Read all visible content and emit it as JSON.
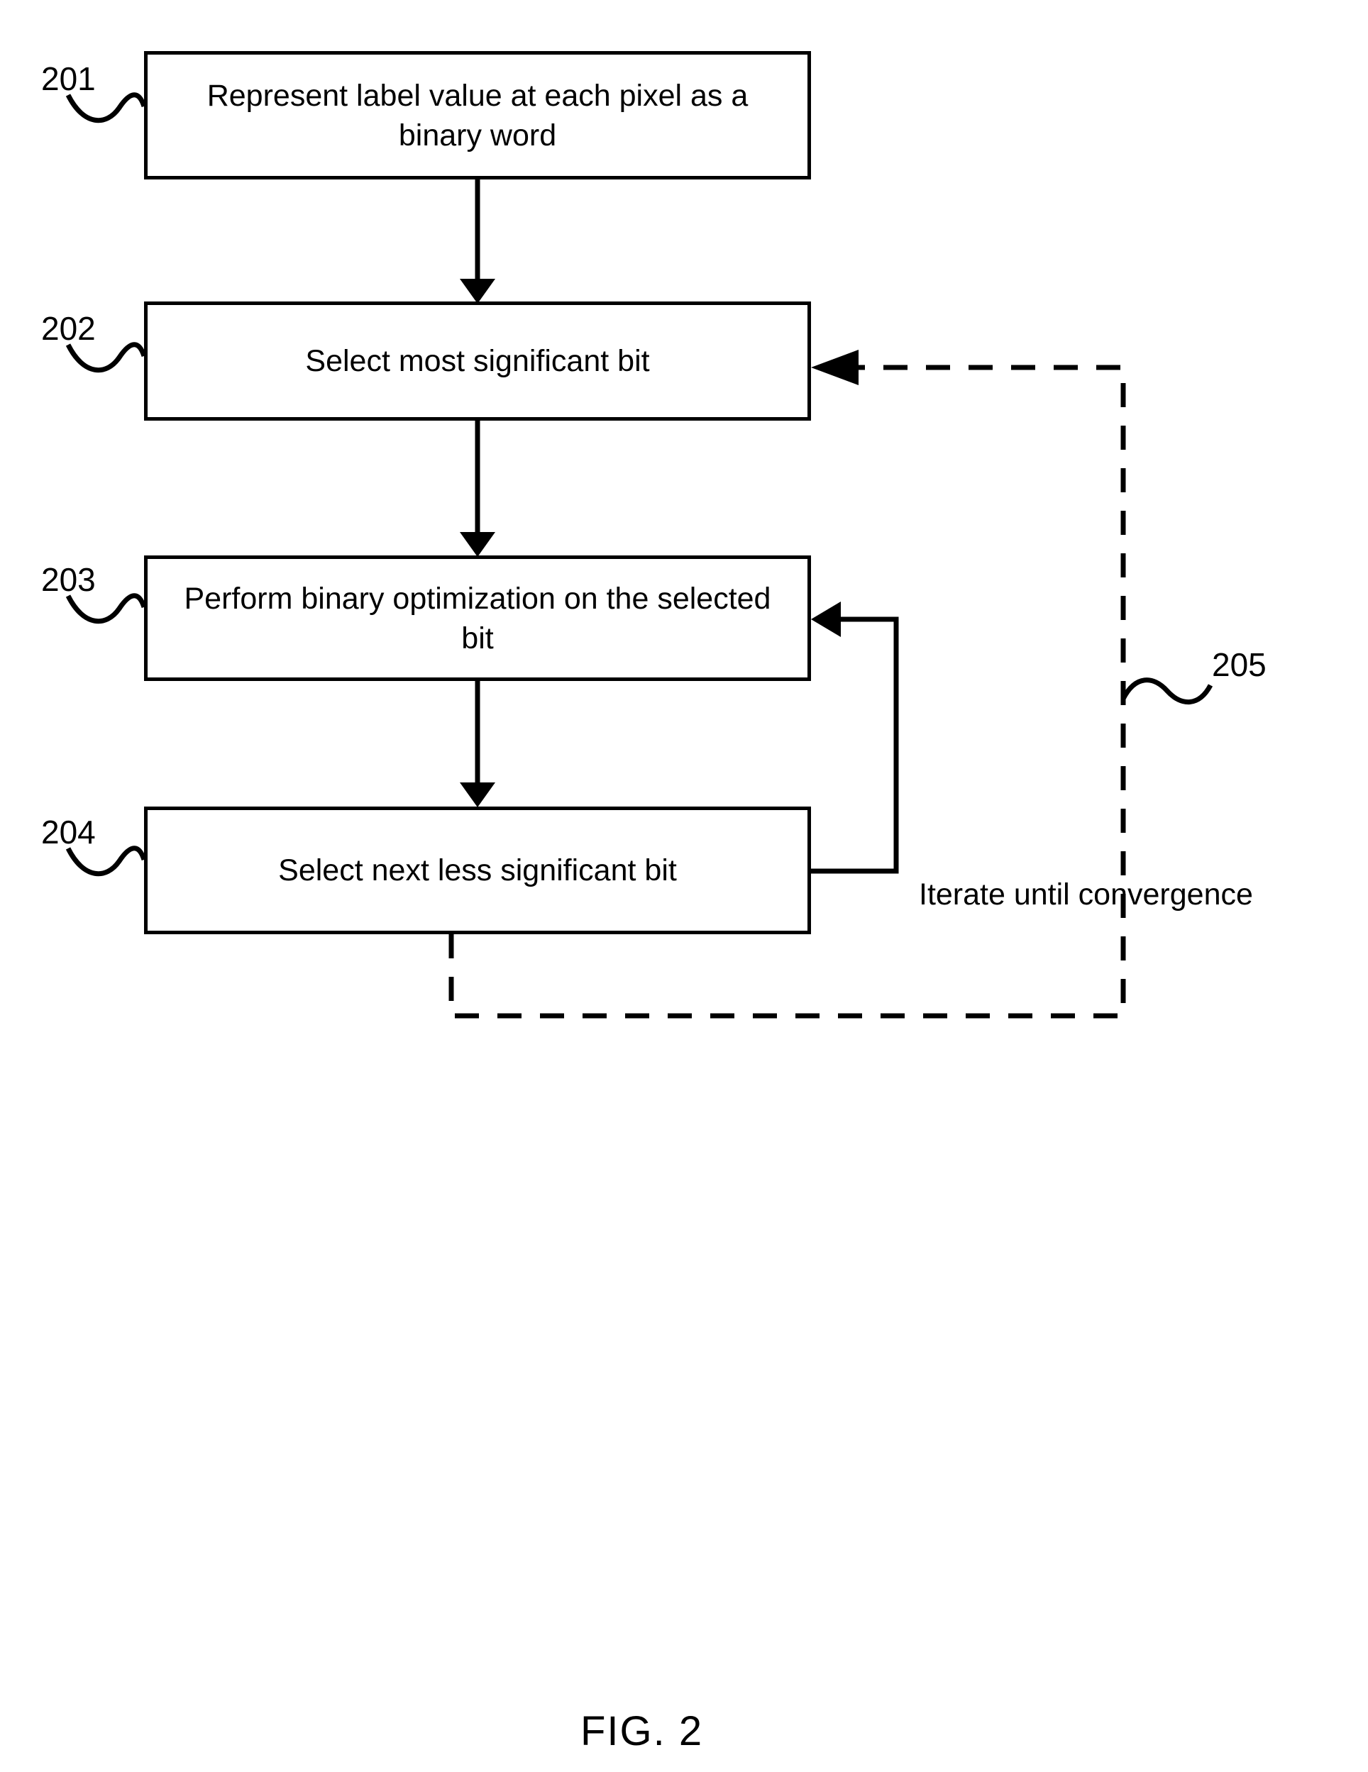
{
  "figure": {
    "caption": "FIG. 2",
    "type": "flowchart"
  },
  "steps": [
    {
      "ref": "201",
      "label": "Represent label value at each pixel as a binary word"
    },
    {
      "ref": "202",
      "label": "Select most significant bit"
    },
    {
      "ref": "203",
      "label": "Perform binary optimization on the selected bit"
    },
    {
      "ref": "204",
      "label": "Select next less significant bit"
    }
  ],
  "annotations": {
    "loop_ref": "205",
    "loop_text": "Iterate until convergence"
  },
  "colors": {
    "stroke": "#000000",
    "background": "#ffffff"
  }
}
